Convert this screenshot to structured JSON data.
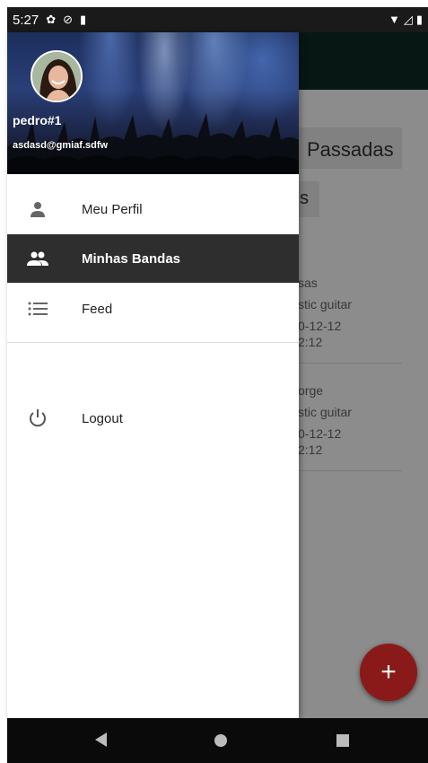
{
  "status_bar": {
    "time": "5:27"
  },
  "background_app": {
    "tab_passadas": "Passadas",
    "tab_second_fragment": "s",
    "cards": [
      {
        "line1": "sas",
        "line2": "stic guitar",
        "line3": "0-12-12",
        "line4": "2:12"
      },
      {
        "line1": "orge",
        "line2": "stic guitar",
        "line3": "0-12-12",
        "line4": "2:12"
      }
    ],
    "fab_label": "+"
  },
  "drawer": {
    "user_name": "pedro#1",
    "user_email": "asdasd@gmiaf.sdfw",
    "items": [
      {
        "label": "Meu Perfil",
        "icon": "person-icon",
        "active": false
      },
      {
        "label": "Minhas Bandas",
        "icon": "group-icon",
        "active": true
      },
      {
        "label": "Feed",
        "icon": "list-icon",
        "active": false
      },
      {
        "label": "Logout",
        "icon": "power-icon",
        "active": false
      }
    ]
  },
  "colors": {
    "active_item_bg": "#2e2e2e",
    "toolbar": "#0d2b26",
    "fab": "#8a1a1a"
  }
}
